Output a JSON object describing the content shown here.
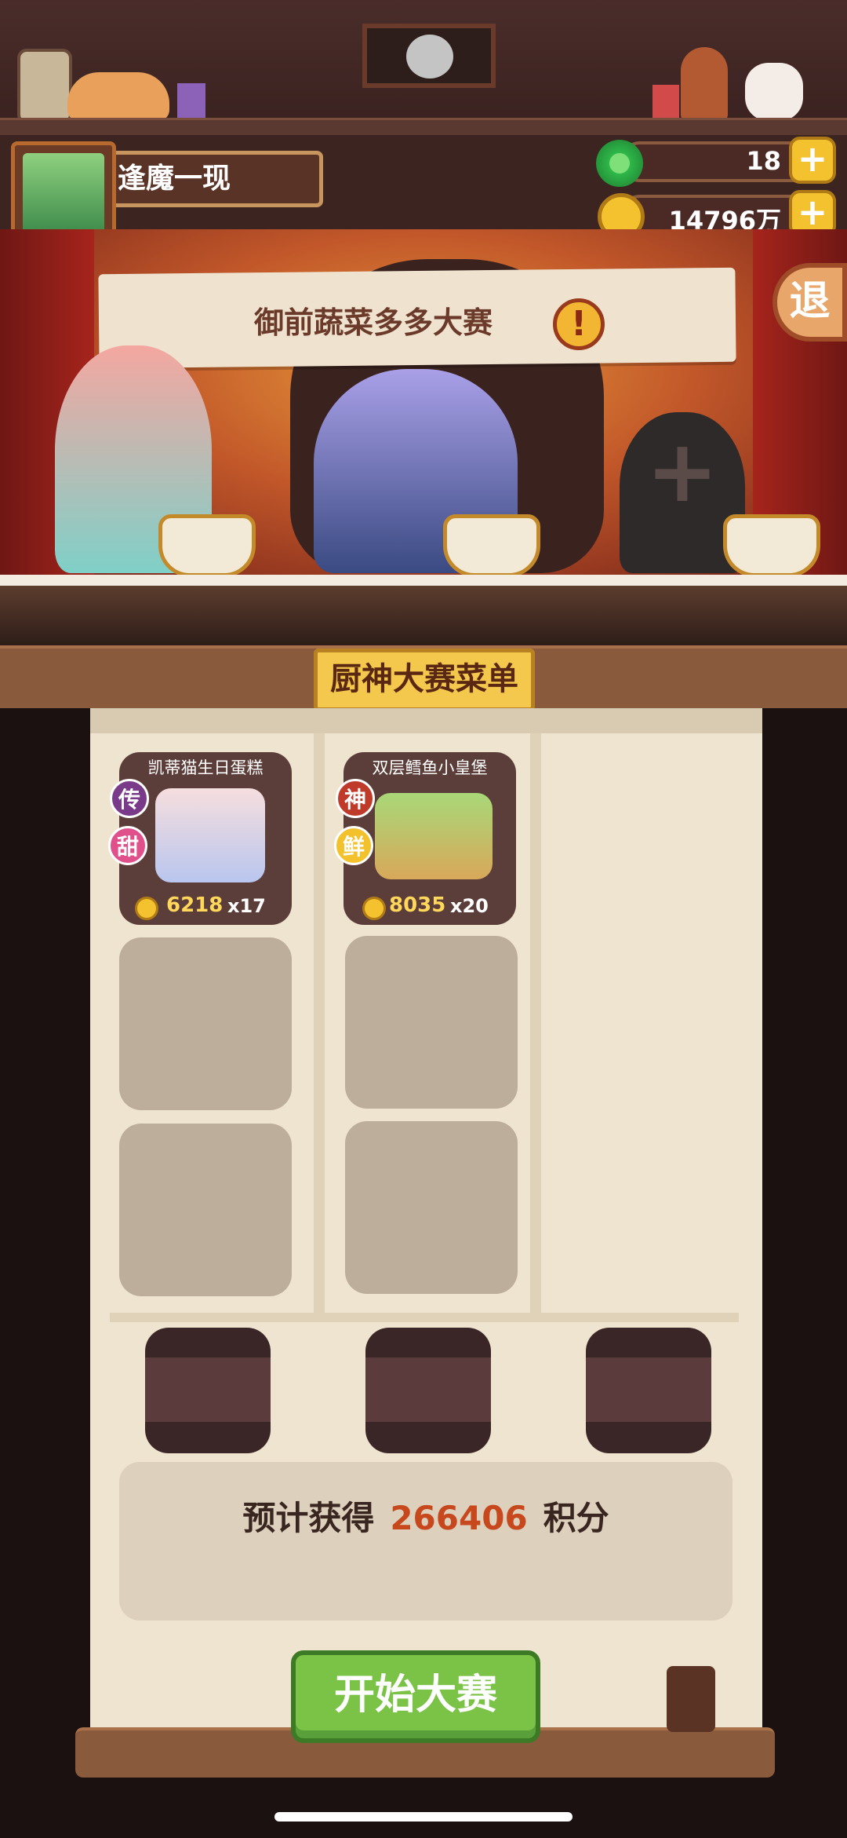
{
  "player": {
    "name": "逢魔一现"
  },
  "currency": {
    "jade": {
      "value": "18",
      "icon": "jade-icon",
      "color": "#2fb84a"
    },
    "coins": {
      "value": "14796万",
      "icon": "coin-icon",
      "color": "#f4c22f"
    },
    "plus_label": "+"
  },
  "stage": {
    "banner_title": "御前蔬菜多多大赛",
    "alert_label": "!",
    "exit_label": "退",
    "add_chef_label": "+"
  },
  "menu": {
    "title": "厨神大赛菜单",
    "dishes": [
      {
        "name": "凯蒂猫生日蛋糕",
        "rarity": "传",
        "flavor": "甜",
        "price": "6218",
        "qty": "x17",
        "rarity_color": "#7a3a8a",
        "flavor_color": "#e0508a"
      },
      {
        "name": "双层鳕鱼小皇堡",
        "rarity": "神",
        "flavor": "鲜",
        "price": "8035",
        "qty": "x20",
        "rarity_color": "#c03a2a",
        "flavor_color": "#f2c12c"
      }
    ]
  },
  "score": {
    "prefix": "预计获得",
    "value": "266406",
    "suffix": "积分"
  },
  "start_button": "开始大赛",
  "colors": {
    "accent": "#f4c84c",
    "primary_button": "#7bc346",
    "score_highlight": "#c6481c"
  }
}
